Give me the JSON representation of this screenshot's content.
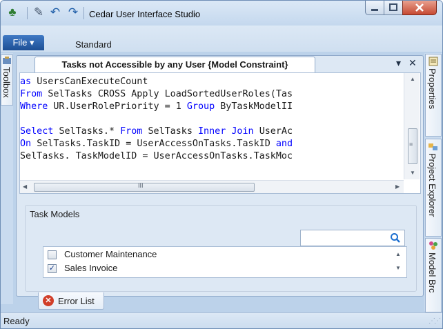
{
  "window": {
    "title": "Cedar User Interface Studio"
  },
  "quick_access": {
    "icons": [
      "tree-icon",
      "customize-icon",
      "undo-icon",
      "redo-icon"
    ]
  },
  "menu": {
    "file_label": "File ▾",
    "toolbar_label": "Standard"
  },
  "left_panel": {
    "toolbox_label": "Toolbox"
  },
  "right_panel": {
    "tabs": [
      {
        "label": "Properties"
      },
      {
        "label": "Project Explorer"
      },
      {
        "label": "Model Brc"
      }
    ]
  },
  "document": {
    "tab_title": "Tasks not Accessible by any User {Model Constraint}",
    "dropdown_glyph": "▾",
    "close_glyph": "✕"
  },
  "code": {
    "lines": [
      "as UsersCanExecuteCount",
      "From SelTasks CROSS Apply LoadSortedUserRoles(Tas",
      "Where UR.UserRolePriority = 1 Group ByTaskModelII",
      "",
      "Select SelTasks.* From SelTasks Inner Join UserAc",
      "On SelTasks.TaskID = UserAccessOnTasks.TaskID and",
      "SelTasks. TaskModelID = UserAccessOnTasks.TaskMoc"
    ],
    "keywords": [
      "as",
      "From",
      "Where",
      "Group",
      "Select",
      "Inner",
      "Join",
      "On",
      "and"
    ],
    "scrollbar_thumb_glyph": "III"
  },
  "task_models": {
    "group_label": "Task Models",
    "search_value": "",
    "items": [
      {
        "label": "Customer Maintenance",
        "checked": false
      },
      {
        "label": "Sales Invoice",
        "checked": true
      }
    ]
  },
  "bottom_panel": {
    "error_list_label": "Error List"
  },
  "status": {
    "text": "Ready"
  },
  "colors": {
    "keyword": "#0000ff",
    "accent": "#1d4f95",
    "error": "#d13f2a"
  }
}
